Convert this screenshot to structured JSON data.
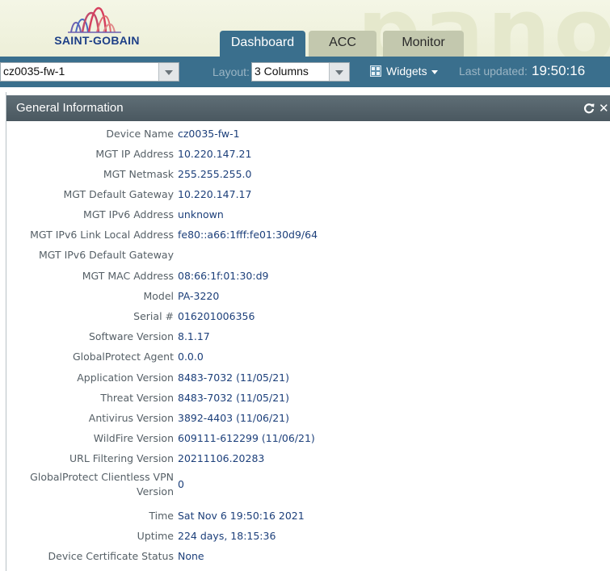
{
  "brand": {
    "logo_text": "SAINT-GOBAIN",
    "background_word": "pano"
  },
  "tabs": [
    {
      "label": "Dashboard",
      "active": true
    },
    {
      "label": "ACC",
      "active": false
    },
    {
      "label": "Monitor",
      "active": false
    }
  ],
  "toolbar": {
    "device": "cz0035-fw-1",
    "layout_label": "Layout:",
    "layout_value": "3 Columns",
    "widgets_label": "Widgets",
    "updated_label": "Last updated:",
    "updated_time": "19:50:16"
  },
  "panel": {
    "title": "General Information",
    "rows": [
      {
        "label": "Device Name",
        "value": "cz0035-fw-1"
      },
      {
        "label": "MGT IP Address",
        "value": "10.220.147.21"
      },
      {
        "label": "MGT Netmask",
        "value": "255.255.255.0"
      },
      {
        "label": "MGT Default Gateway",
        "value": "10.220.147.17"
      },
      {
        "label": "MGT IPv6 Address",
        "value": "unknown"
      },
      {
        "label": "MGT IPv6 Link Local Address",
        "value": "fe80::a66:1fff:fe01:30d9/64"
      },
      {
        "label": "MGT IPv6 Default Gateway",
        "value": ""
      },
      {
        "label": "MGT MAC Address",
        "value": "08:66:1f:01:30:d9"
      },
      {
        "label": "Model",
        "value": "PA-3220"
      },
      {
        "label": "Serial #",
        "value": "016201006356"
      },
      {
        "label": "Software Version",
        "value": "8.1.17"
      },
      {
        "label": "GlobalProtect Agent",
        "value": "0.0.0"
      },
      {
        "label": "Application Version",
        "value": "8483-7032 (11/05/21)"
      },
      {
        "label": "Threat Version",
        "value": "8483-7032 (11/05/21)"
      },
      {
        "label": "Antivirus Version",
        "value": "3892-4403 (11/06/21)"
      },
      {
        "label": "WildFire Version",
        "value": "609111-612299 (11/06/21)"
      },
      {
        "label": "URL Filtering Version",
        "value": "20211106.20283"
      },
      {
        "label": "GlobalProtect Clientless VPN Version",
        "value": "0"
      },
      {
        "label": "Time",
        "value": "Sat Nov 6 19:50:16 2021"
      },
      {
        "label": "Uptime",
        "value": "224 days, 18:15:36"
      },
      {
        "label": "Device Certificate Status",
        "value": "None"
      }
    ]
  },
  "colors": {
    "toolbar": "#3a6f8d",
    "value_text": "#1c3f7a",
    "label_text": "#555f66",
    "panel_header": "#4f5d65"
  }
}
